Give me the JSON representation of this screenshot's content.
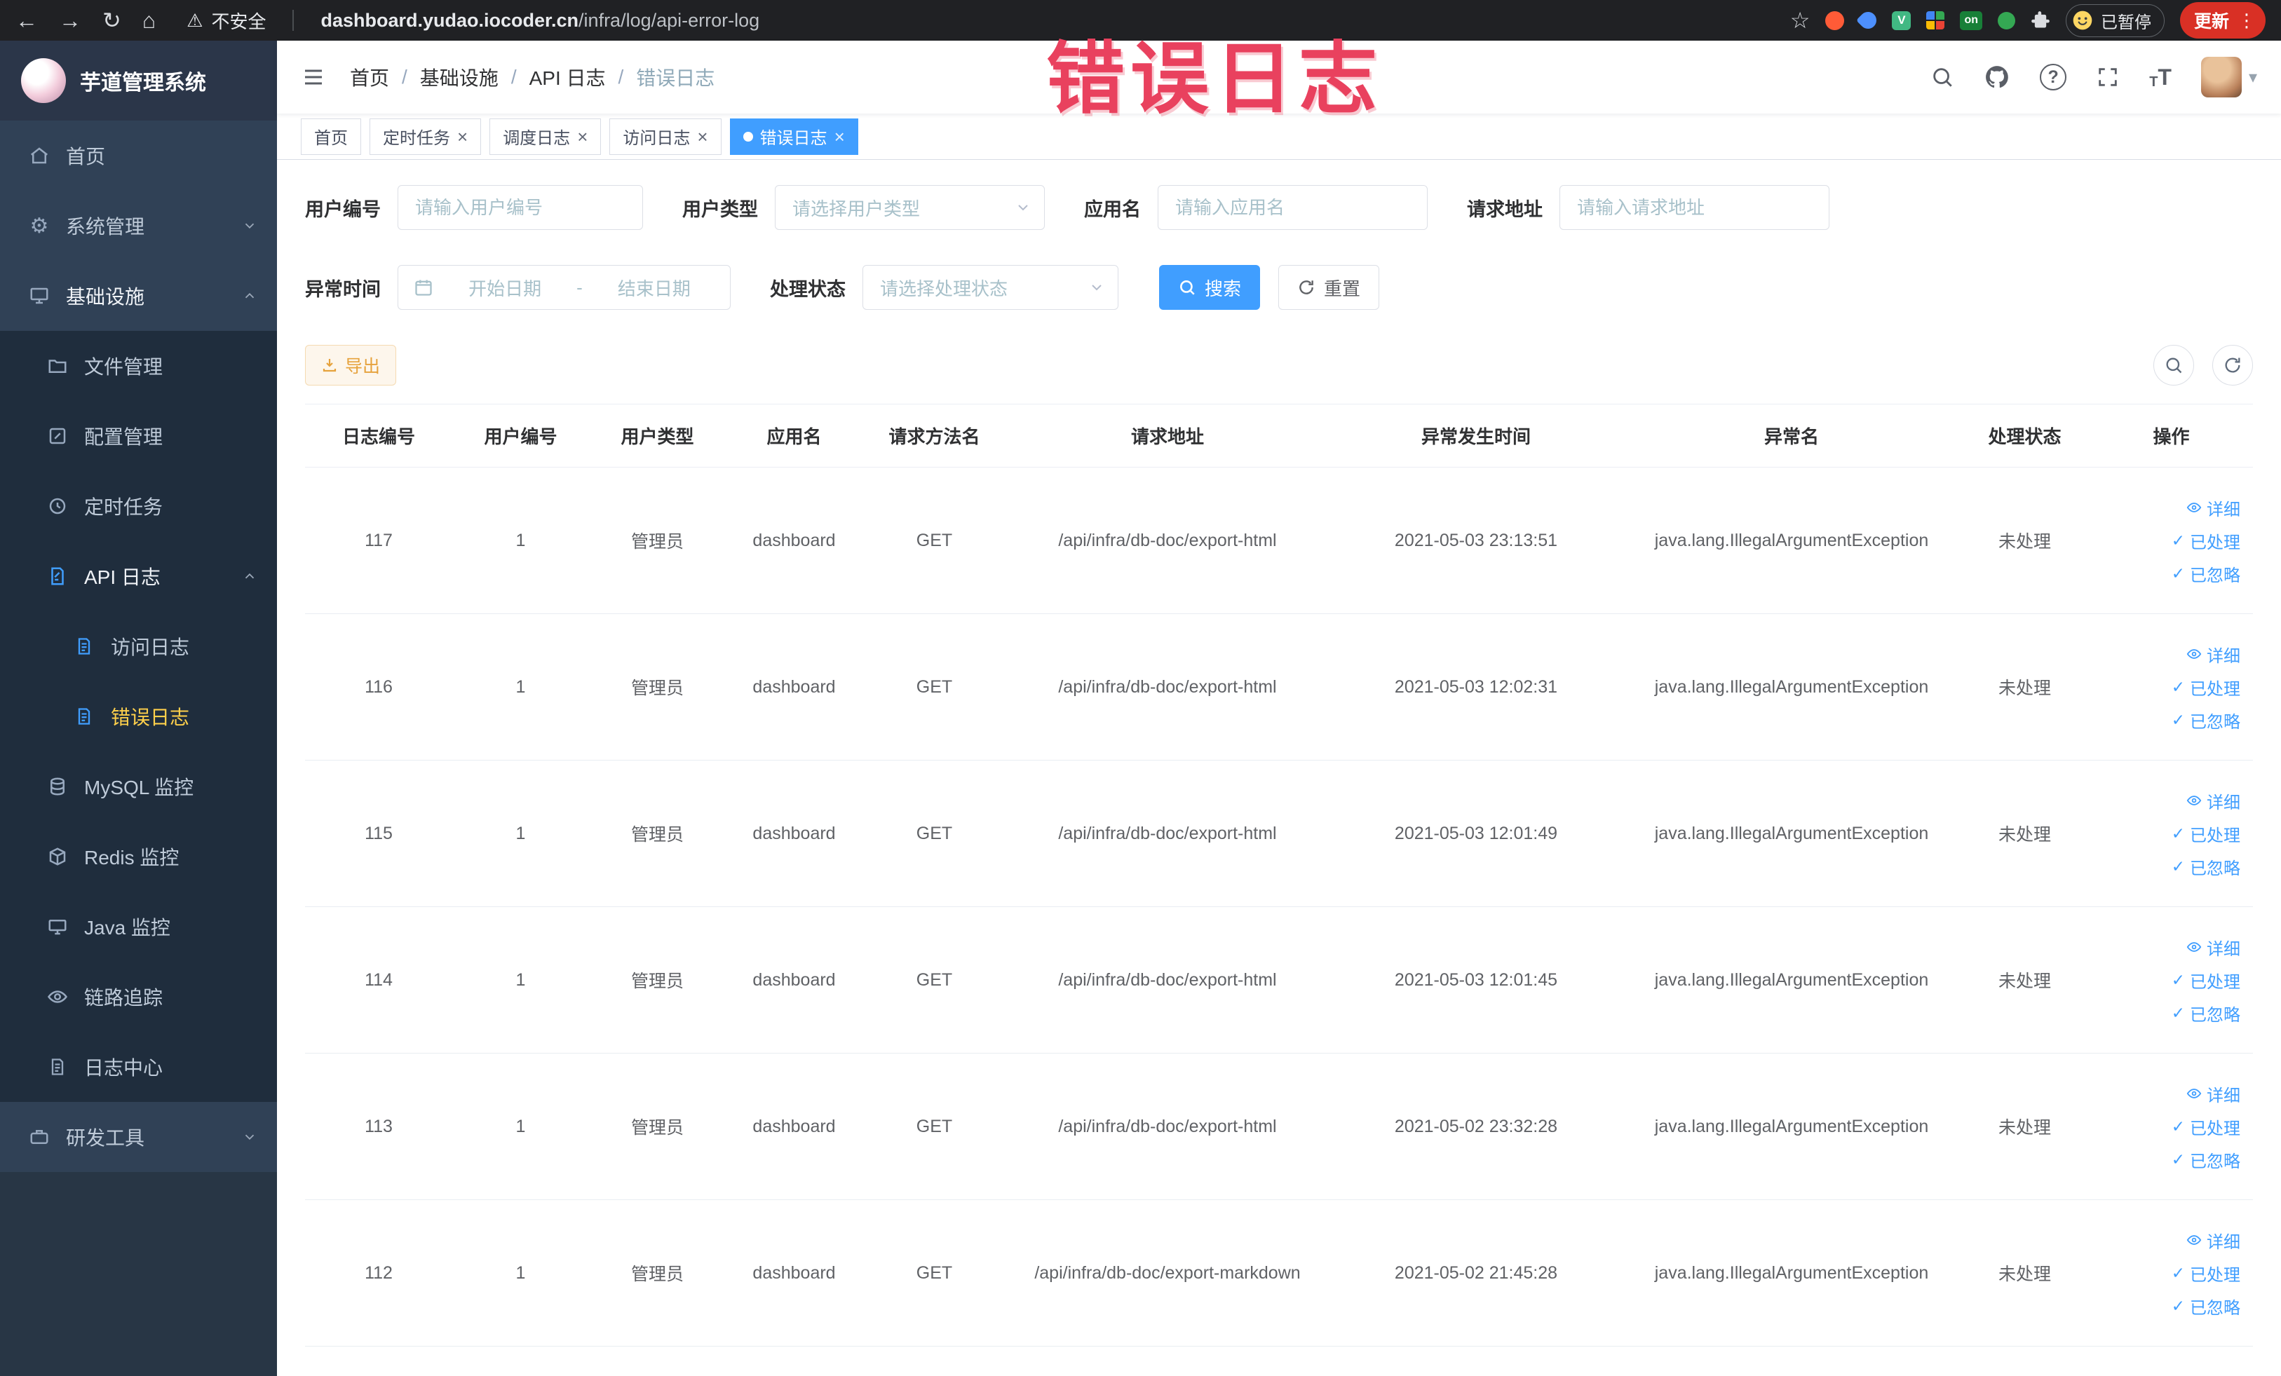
{
  "colors": {
    "accent": "#409eff",
    "sidebar_bg": "#304156",
    "submenu_bg": "#1f2d3d",
    "sidebar_active_text": "#ffd04b",
    "export_text": "#e6a23c",
    "export_bg": "#fdf6ec",
    "annotation_red": "#e9415e",
    "chrome_bg": "#202124",
    "active_tab_bg": "#409eff"
  },
  "icons": {
    "back": "←",
    "forward": "→",
    "reload": "↻",
    "home": "⌂",
    "warning": "⚠",
    "star": "☆",
    "kebab": "⋮",
    "gear": "⚙",
    "check": "✓",
    "close": "×",
    "caret_down": "▾",
    "question": "?",
    "vue_v": "V",
    "on_badge": "on",
    "t_small": "T",
    "t_large": "T"
  },
  "browser": {
    "security_label": "不安全",
    "url_domain": "dashboard.yudao.iocoder.cn",
    "url_path": "/infra/log/api-error-log",
    "paused_label": "已暂停",
    "update_label": "更新"
  },
  "annotation": {
    "text": "错误日志"
  },
  "sidebar": {
    "logo_title": "芋道管理系统",
    "items": [
      {
        "label": "首页"
      },
      {
        "label": "系统管理"
      },
      {
        "label": "基础设施"
      },
      {
        "label": "文件管理"
      },
      {
        "label": "配置管理"
      },
      {
        "label": "定时任务"
      },
      {
        "label": "API 日志"
      },
      {
        "label": "访问日志"
      },
      {
        "label": "错误日志"
      },
      {
        "label": "MySQL 监控"
      },
      {
        "label": "Redis 监控"
      },
      {
        "label": "Java 监控"
      },
      {
        "label": "链路追踪"
      },
      {
        "label": "日志中心"
      },
      {
        "label": "研发工具"
      }
    ]
  },
  "breadcrumb": {
    "separator": "/",
    "items": [
      "首页",
      "基础设施",
      "API 日志",
      "错误日志"
    ]
  },
  "tabs": {
    "close_icon": "×",
    "items": [
      {
        "label": "首页"
      },
      {
        "label": "定时任务"
      },
      {
        "label": "调度日志"
      },
      {
        "label": "访问日志"
      },
      {
        "label": "错误日志"
      }
    ]
  },
  "filters": {
    "user_id": {
      "label": "用户编号",
      "placeholder": "请输入用户编号"
    },
    "user_type": {
      "label": "用户类型",
      "placeholder": "请选择用户类型"
    },
    "app_name": {
      "label": "应用名",
      "placeholder": "请输入应用名"
    },
    "request_url": {
      "label": "请求地址",
      "placeholder": "请输入请求地址"
    },
    "exception_time": {
      "label": "异常时间",
      "start_placeholder": "开始日期",
      "separator": "-",
      "end_placeholder": "结束日期"
    },
    "process_status": {
      "label": "处理状态",
      "placeholder": "请选择处理状态"
    },
    "search_label": "搜索",
    "reset_label": "重置"
  },
  "toolbar": {
    "export_label": "导出"
  },
  "table": {
    "headers": [
      "日志编号",
      "用户编号",
      "用户类型",
      "应用名",
      "请求方法名",
      "请求地址",
      "异常发生时间",
      "异常名",
      "处理状态",
      "操作"
    ],
    "row_actions": {
      "detail": "详细",
      "processed": "已处理",
      "ignored": "已忽略"
    },
    "rows": [
      {
        "id": "117",
        "user_id": "1",
        "user_type": "管理员",
        "app_name": "dashboard",
        "method": "GET",
        "url": "/api/infra/db-doc/export-html",
        "time": "2021-05-03 23:13:51",
        "exception": "java.lang.IllegalArgumentException",
        "status": "未处理"
      },
      {
        "id": "116",
        "user_id": "1",
        "user_type": "管理员",
        "app_name": "dashboard",
        "method": "GET",
        "url": "/api/infra/db-doc/export-html",
        "time": "2021-05-03 12:02:31",
        "exception": "java.lang.IllegalArgumentException",
        "status": "未处理"
      },
      {
        "id": "115",
        "user_id": "1",
        "user_type": "管理员",
        "app_name": "dashboard",
        "method": "GET",
        "url": "/api/infra/db-doc/export-html",
        "time": "2021-05-03 12:01:49",
        "exception": "java.lang.IllegalArgumentException",
        "status": "未处理"
      },
      {
        "id": "114",
        "user_id": "1",
        "user_type": "管理员",
        "app_name": "dashboard",
        "method": "GET",
        "url": "/api/infra/db-doc/export-html",
        "time": "2021-05-03 12:01:45",
        "exception": "java.lang.IllegalArgumentException",
        "status": "未处理"
      },
      {
        "id": "113",
        "user_id": "1",
        "user_type": "管理员",
        "app_name": "dashboard",
        "method": "GET",
        "url": "/api/infra/db-doc/export-html",
        "time": "2021-05-02 23:32:28",
        "exception": "java.lang.IllegalArgumentException",
        "status": "未处理"
      },
      {
        "id": "112",
        "user_id": "1",
        "user_type": "管理员",
        "app_name": "dashboard",
        "method": "GET",
        "url": "/api/infra/db-doc/export-markdown",
        "time": "2021-05-02 21:45:28",
        "exception": "java.lang.IllegalArgumentException",
        "status": "未处理"
      }
    ]
  }
}
